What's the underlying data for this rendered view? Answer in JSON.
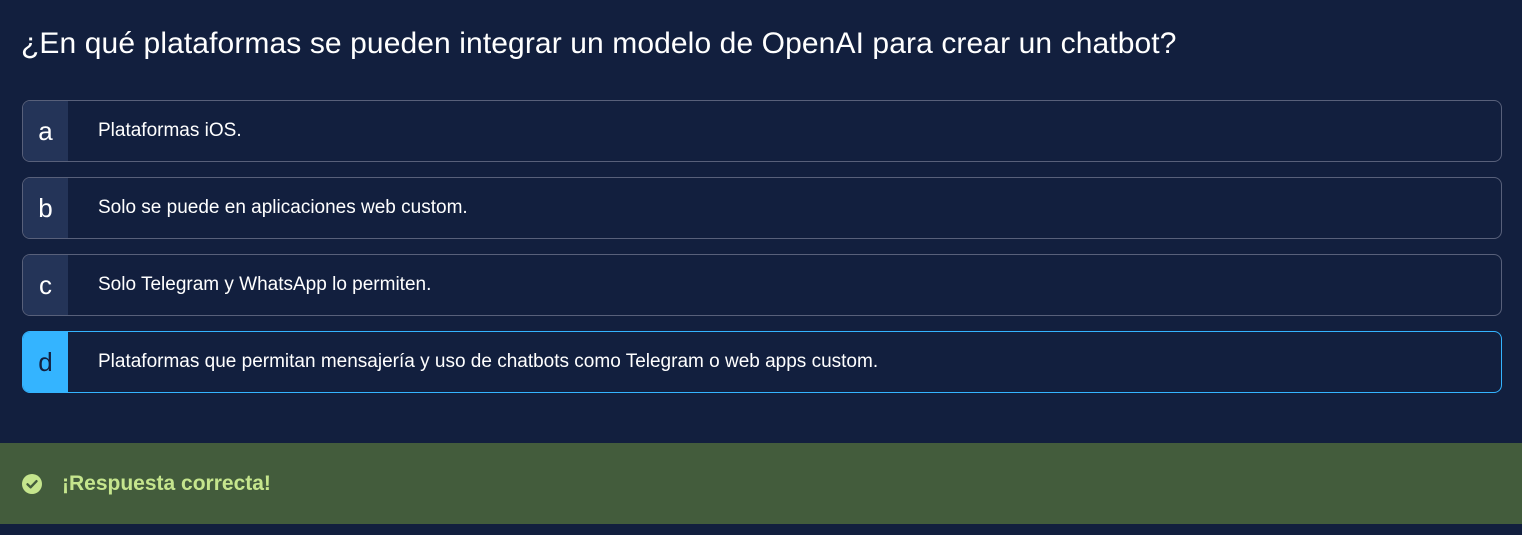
{
  "question": "¿En qué plataformas se pueden integrar un modelo de OpenAI para crear un chatbot?",
  "options": [
    {
      "letter": "a",
      "text": "Plataformas iOS."
    },
    {
      "letter": "b",
      "text": "Solo se puede en aplicaciones web custom."
    },
    {
      "letter": "c",
      "text": "Solo Telegram y WhatsApp lo permiten."
    },
    {
      "letter": "d",
      "text": "Plataformas que permitan mensajería y uso de chatbots como Telegram o web apps custom."
    }
  ],
  "selected_option": "d",
  "feedback": {
    "icon": "check-circle-icon",
    "message": "¡Respuesta correcta!"
  },
  "colors": {
    "background": "#121f3e",
    "selected_accent": "#34b4ff",
    "feedback_background": "#435c3c",
    "feedback_text": "#c5e58d"
  }
}
